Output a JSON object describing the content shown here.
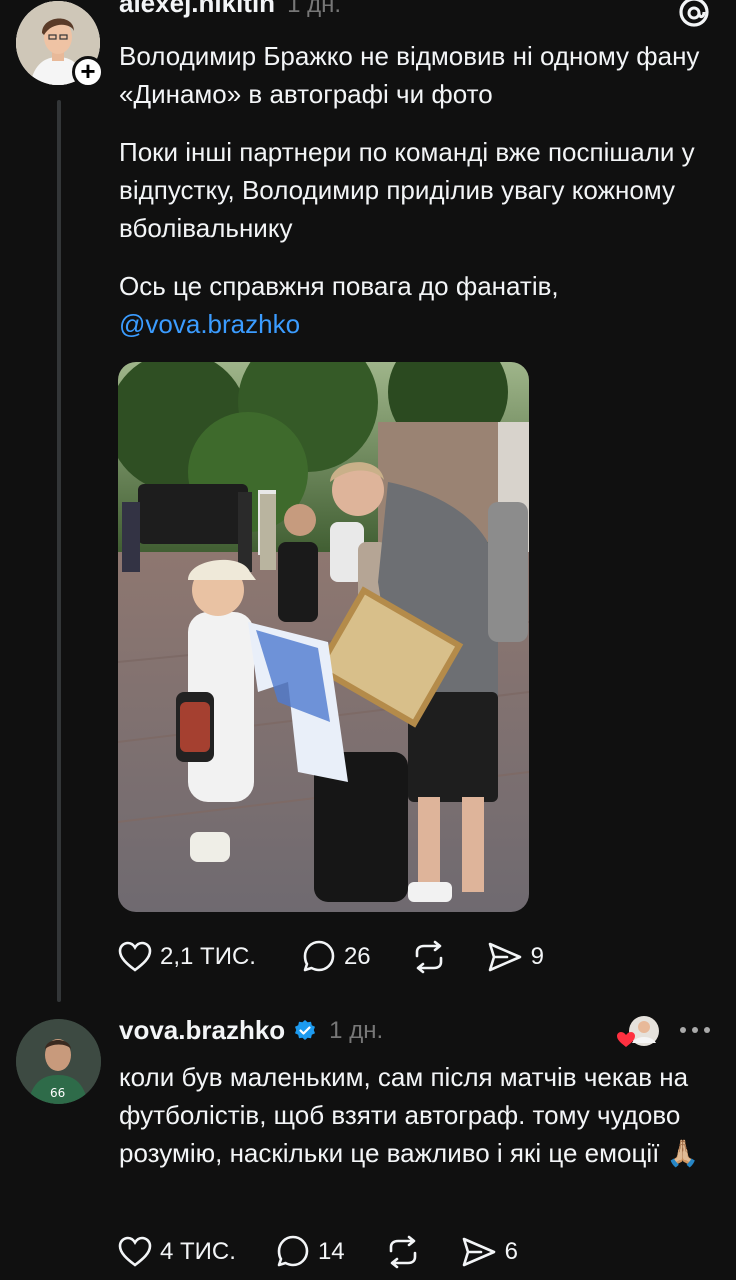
{
  "post": {
    "username": "alexej.nikitin",
    "time": "1 дн.",
    "paragraphs": [
      "Володимир Бражко не відмовив ні одному фану «Динамо» в автографі чи фото",
      "Поки інші партнери по команді вже поспішали у відпустку, Володимир приділив увагу кожному вболівальнику",
      "Ось це справжня повага до фанатів,"
    ],
    "mention": "@vova.brazhko",
    "stats": {
      "likes": "2,1 ТИС.",
      "comments": "26",
      "shares": "9"
    }
  },
  "reply": {
    "username": "vova.brazhko",
    "time": "1 дн.",
    "text": "коли був маленьким, сам після матчів чекав на футболістів, щоб взяти автограф. тому чудово розумію, наскільки це важливо і які це емоції",
    "emoji": "🙏🏼",
    "stats": {
      "likes": "4 ТИС.",
      "comments": "14",
      "shares": "6"
    }
  },
  "colors": {
    "background": "#101010",
    "text": "#f3f5f7",
    "secondary": "#777777",
    "mention": "#3b9cff",
    "verified": "#1d9bf0",
    "like_heart": "#ff3040"
  }
}
